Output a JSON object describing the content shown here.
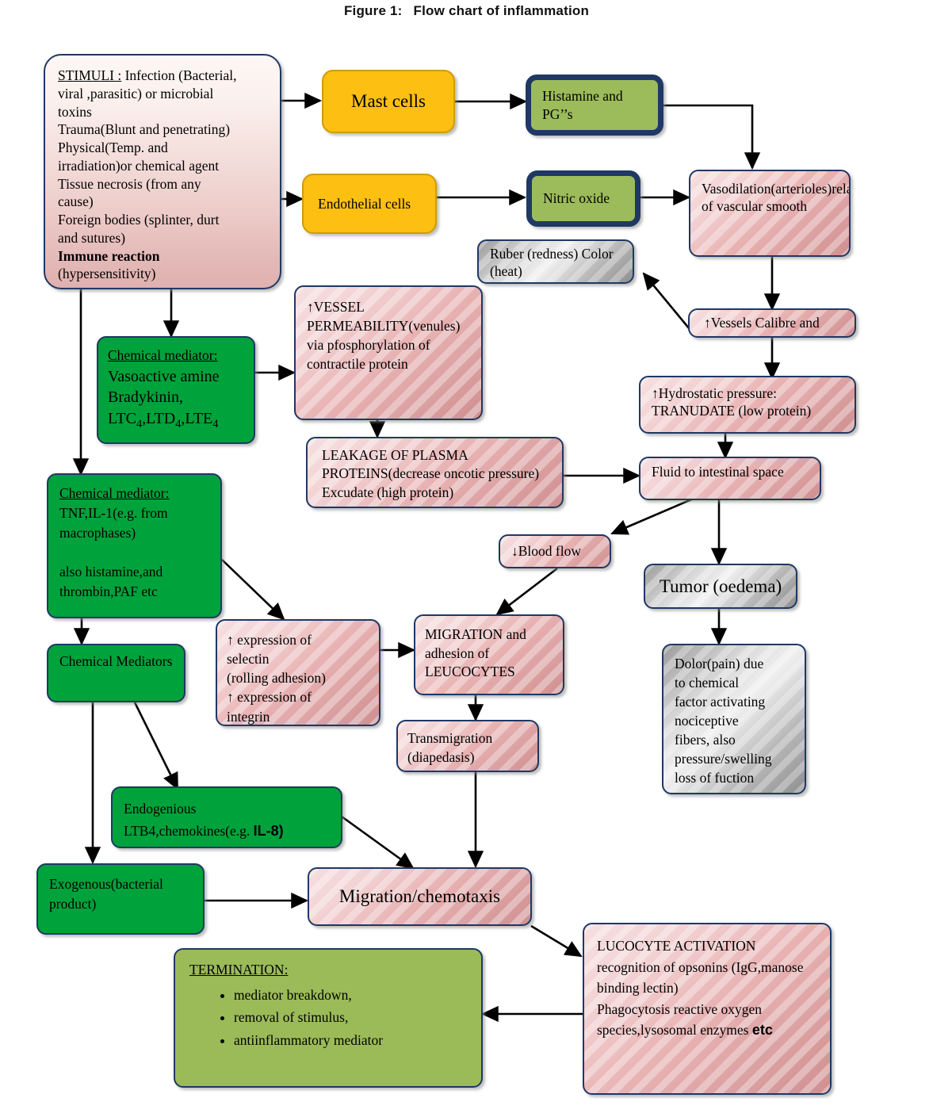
{
  "figure": {
    "label": "Figure 1:",
    "title": "Flow chart of inflammation"
  },
  "nodes": {
    "stimuli": {
      "heading": "STIMULI :",
      "lines": [
        " Infection (Bacterial,",
        "viral ,parasitic) or microbial",
        "toxins",
        "Trauma(Blunt and penetrating)",
        "Physical(Temp. and",
        "irradiation)or chemical agent",
        "Tissue necrosis (from any",
        "cause)",
        "Foreign bodies (splinter, durt",
        "and sutures)"
      ],
      "immune_prefix": "Immune ",
      "immune_bold": "reaction",
      "immune_tail": "(hypersensitivity)"
    },
    "mast_cells": "Mast cells",
    "endothelial_cells": "Endothelial cells",
    "histamine": "Histamine and PG’’s",
    "nitric_oxide": "Nitric oxide",
    "vasodilation": "Vasodilation(arterioles)relaxation of vascular smooth",
    "ruber": "Ruber (redness) Color (heat)",
    "vessels_calibre": "↑Vessels Calibre and",
    "hydrostatic": "↑Hydrostatic pressure: TRANUDATE (low protein)",
    "chem_med_vaso": {
      "heading": "Chemical mediator:",
      "line1": "Vasoactive amine",
      "line2": "Bradykinin,",
      "line3_a": "LTC",
      "line3_s1": "4",
      "line3_b": ",LTD",
      "line3_s2": "4",
      "line3_c": ",LTE",
      "line3_s3": "4"
    },
    "vessel_permeability": "↑VESSEL PERMEABILITY(venules) via pfosphorylation of contractile protein",
    "leakage": "LEAKAGE OF PLASMA PROTEINS(decrease oncotic pressure) Excudate (high protein)",
    "fluid_interstitial": "Fluid to intestinal space",
    "chem_med_tnf": {
      "heading": "Chemical mediator:",
      "line1": "TNF,IL-1(e.g. from",
      "line2": "macrophases)",
      "line3": "also histamine,and",
      "line4": "thrombin,PAF etc"
    },
    "chemical_mediators": "Chemical Mediators",
    "blood_flow": "↓Blood flow",
    "tumor": "Tumor (oedema)",
    "selectin": {
      "line1": "↑ expression of",
      "line2": "selectin",
      "line3": "(rolling adhesion)",
      "line4": "↑ expression of",
      "line5": "integrin"
    },
    "migration_adhesion": "MIGRATION and adhesion of LEUCOCYTES",
    "transmigration": "Transmigration (diapedasis)",
    "dolor": {
      "line1": "Dolor(pain) due",
      "line2": "to chemical",
      "line3": "factor activating",
      "line4": "nociceptive",
      "line5": "fibers, also",
      "line6": "pressure/swelling",
      "line7": "loss of fuction"
    },
    "endogenious": {
      "line1": "Endogenious",
      "line2_a": "LTB4,chemokines(e.g. ",
      "line2_b": "IL-8)"
    },
    "exogenous": "Exogenous(bacterial product)",
    "migration_chemotaxis": "Migration/chemotaxis",
    "lucocyte_activation": {
      "line1": "LUCOCYTE ACTIVATION",
      "line2": "recognition of opsonins (IgG,manose",
      "line3": "binding lectin)",
      "line4": "Phagocytosis reactive oxygen",
      "line5_a": "species,lysosomal enzymes ",
      "line5_b": "etc"
    },
    "termination": {
      "heading": "TERMINATION:",
      "items": [
        "mediator breakdown,",
        "removal of stimulus,",
        "antiinflammatory mediator"
      ]
    }
  },
  "colors": {
    "border_navy": "#1F3864",
    "green": "#00A23B",
    "olive": "#9BBB59",
    "orange": "#FCBF12",
    "pink_light": "#F6DFE0",
    "pink_dark": "#D08F90",
    "gray_light": "#F0F0F0",
    "gray_dark": "#8F8F8F",
    "arrow": "#000000"
  }
}
